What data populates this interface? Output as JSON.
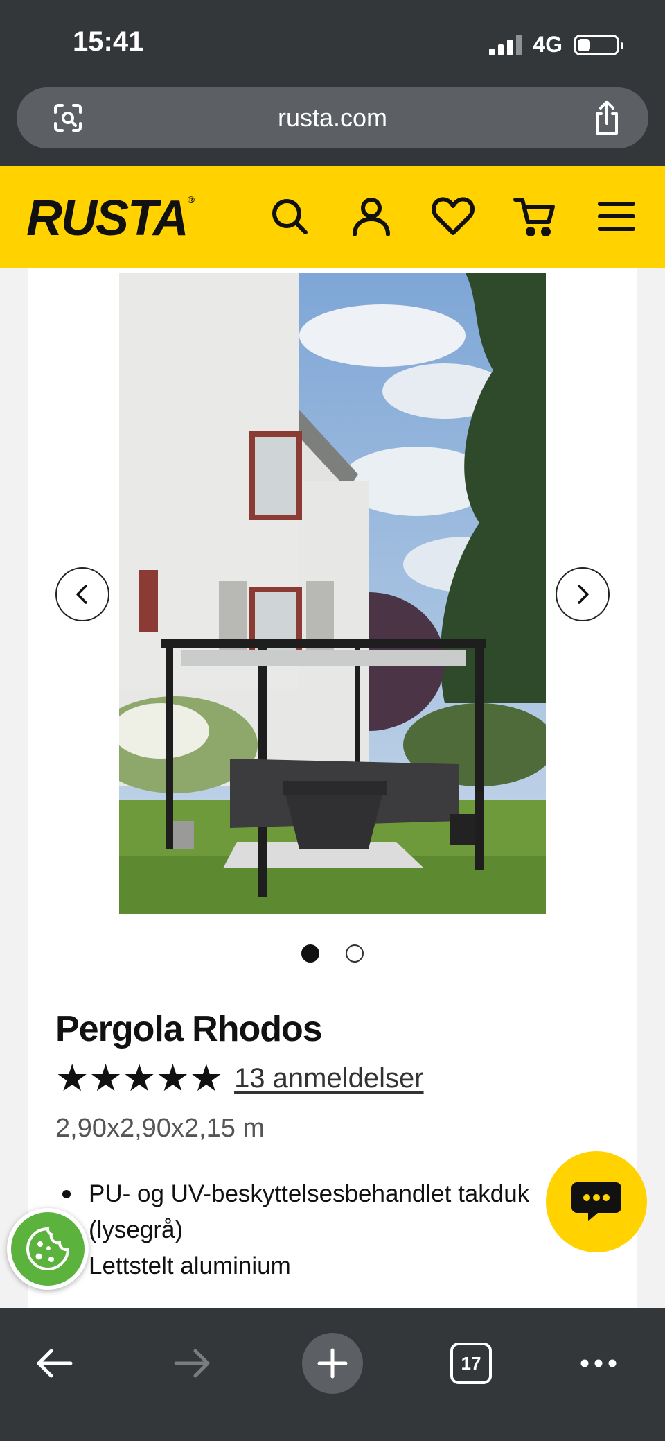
{
  "status_bar": {
    "time": "15:41",
    "network": "4G",
    "battery_level": 0.34
  },
  "browser": {
    "url": "rusta.com",
    "tab_count": "17"
  },
  "header": {
    "logo": "RUSTA",
    "logo_mark": "®",
    "icons": [
      "search-icon",
      "account-icon",
      "wishlist-heart-icon",
      "cart-icon",
      "menu-icon"
    ],
    "accent_color": "#ffd200"
  },
  "product": {
    "title": "Pergola Rhodos",
    "stars": "★★★★★",
    "rating_value": 5,
    "reviews_label": "13 anmeldelser",
    "dimensions": "2,90x2,90x2,15 m",
    "features": [
      "PU- og UV-beskyttelsesbehandlet takduk (lysegrå)",
      "Lettstelt aluminium"
    ],
    "gallery": {
      "current": 1,
      "total": 2
    }
  },
  "colors": {
    "chat_button": "#ffd200",
    "cookie_button": "#5bb23c",
    "toolbar": "#33373a"
  }
}
